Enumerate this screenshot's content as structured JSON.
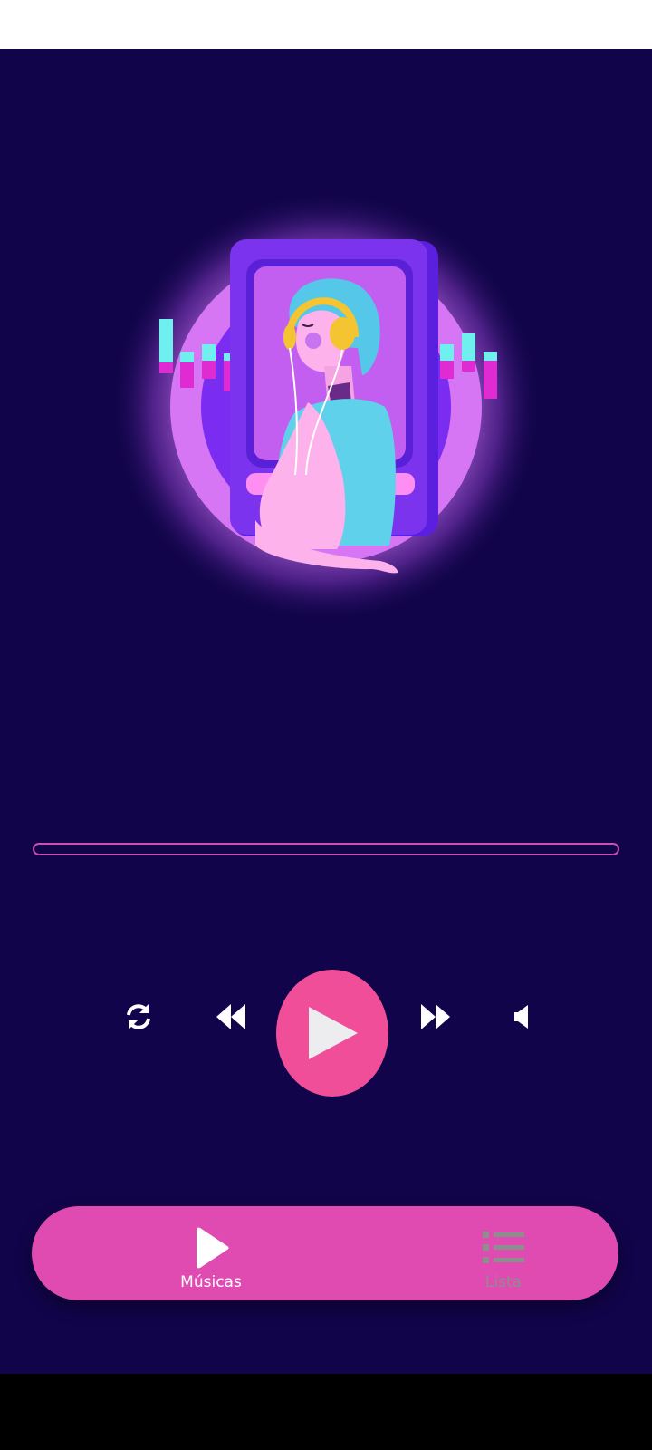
{
  "colors": {
    "background": "#11044a",
    "accent": "#f04e98",
    "tab_bar": "#df4bb0",
    "progress_border": "#c94fb7",
    "inactive": "#8e8e8e"
  },
  "player": {
    "progress": 0,
    "controls": {
      "repeat_icon": "repeat-icon",
      "previous_icon": "rewind-icon",
      "play_icon": "play-icon",
      "next_icon": "fast-forward-icon",
      "volume_icon": "volume-icon"
    }
  },
  "tabs": [
    {
      "label": "Músicas",
      "icon": "play-icon",
      "active": true
    },
    {
      "label": "Lista",
      "icon": "list-icon",
      "active": false
    }
  ]
}
